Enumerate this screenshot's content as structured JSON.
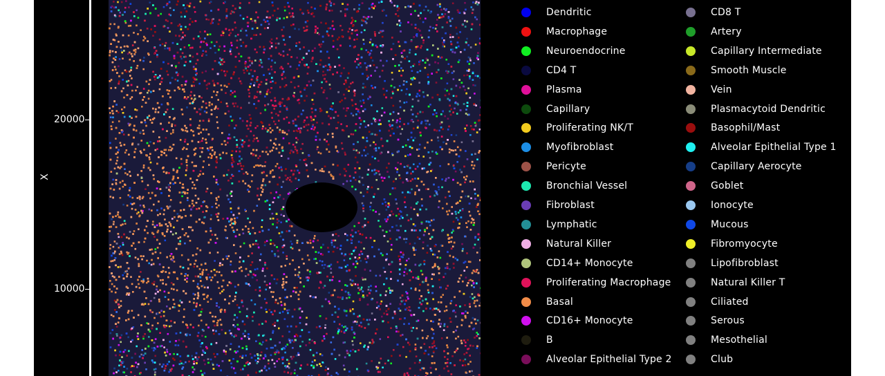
{
  "chart_data": {
    "type": "scatter",
    "title": "",
    "xlabel": "",
    "ylabel": "X",
    "y_ticks": [
      "20000",
      "10000"
    ],
    "y_tick_values": [
      20000,
      10000
    ],
    "ylim": [
      3000,
      25200
    ],
    "grid": false,
    "legend_placement": "right",
    "background": "#000000",
    "series": [
      {
        "name": "Dendritic",
        "color": "#0000ee"
      },
      {
        "name": "Macrophage",
        "color": "#ee1111"
      },
      {
        "name": "Neuroendocrine",
        "color": "#11ee22"
      },
      {
        "name": "CD4 T",
        "color": "#0a0a40"
      },
      {
        "name": "Plasma",
        "color": "#e0109a"
      },
      {
        "name": "Capillary",
        "color": "#0d4a0d"
      },
      {
        "name": "Proliferating NK/T",
        "color": "#f2cb1e"
      },
      {
        "name": "Myofibroblast",
        "color": "#1c8ee6"
      },
      {
        "name": "Pericyte",
        "color": "#9c5248"
      },
      {
        "name": "Bronchial Vessel",
        "color": "#1de8b0"
      },
      {
        "name": "Fibroblast",
        "color": "#6a3db5"
      },
      {
        "name": "Lymphatic",
        "color": "#238f96"
      },
      {
        "name": "Natural Killer",
        "color": "#f0aee6"
      },
      {
        "name": "CD14+ Monocyte",
        "color": "#b0c57c"
      },
      {
        "name": "Proliferating Macrophage",
        "color": "#e0125a"
      },
      {
        "name": "Basal",
        "color": "#f28c48"
      },
      {
        "name": "CD16+ Monocyte",
        "color": "#d010ee"
      },
      {
        "name": "B",
        "color": "#1e1c0f"
      },
      {
        "name": "Alveolar Epithelial Type 2",
        "color": "#7a0e5a"
      },
      {
        "name": "CD8 T",
        "color": "#787090"
      },
      {
        "name": "Artery",
        "color": "#1f9e2a"
      },
      {
        "name": "Capillary Intermediate",
        "color": "#c8e828"
      },
      {
        "name": "Smooth Muscle",
        "color": "#8a6a1a"
      },
      {
        "name": "Vein",
        "color": "#f2b4a0"
      },
      {
        "name": "Plasmacytoid Dendritic",
        "color": "#8a8c78"
      },
      {
        "name": "Basophil/Mast",
        "color": "#9a0e0e"
      },
      {
        "name": "Alveolar Epithelial Type 1",
        "color": "#1ef0f0"
      },
      {
        "name": "Capillary Aerocyte",
        "color": "#163e88"
      },
      {
        "name": "Goblet",
        "color": "#d0658a"
      },
      {
        "name": "Ionocyte",
        "color": "#9ac8f0"
      },
      {
        "name": "Mucous",
        "color": "#1048e6"
      },
      {
        "name": "Fibromyocyte",
        "color": "#eeee28"
      },
      {
        "name": "Lipofibroblast",
        "color": "#808080"
      },
      {
        "name": "Natural Killer T",
        "color": "#808080"
      },
      {
        "name": "Ciliated",
        "color": "#808080"
      },
      {
        "name": "Serous",
        "color": "#808080"
      },
      {
        "name": "Mesothelial",
        "color": "#808080"
      },
      {
        "name": "Club",
        "color": "#808080"
      }
    ]
  }
}
